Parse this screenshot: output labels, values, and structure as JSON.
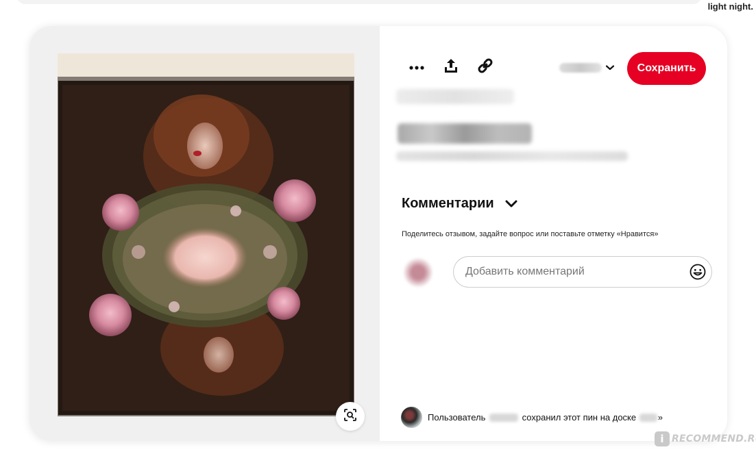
{
  "page": {
    "corner_text": "light night."
  },
  "toolbar": {
    "more_icon": "more-dots-icon",
    "share_icon": "share-upload-icon",
    "link_icon": "link-chain-icon",
    "board_chevron_icon": "chevron-down-icon",
    "save_label": "Сохранить"
  },
  "comments": {
    "title": "Комментарии",
    "chevron_icon": "chevron-down-icon",
    "hint": "Поделитесь отзывом, задайте вопрос или поставьте отметку «Нравится»",
    "input_placeholder": "Добавить комментарий",
    "emoji_icon": "smiley-icon"
  },
  "saved_by": {
    "prefix": "Пользователь",
    "middle": "сохранил этот пин на доске",
    "suffix": "»"
  },
  "visual_search": {
    "icon": "visual-search-icon"
  },
  "watermark": {
    "badge": "i",
    "text": "RECOMMEND.RU"
  },
  "colors": {
    "save_button": "#e60023",
    "photo_bg": "#2b1e17",
    "frame": "#f8f1ea"
  }
}
